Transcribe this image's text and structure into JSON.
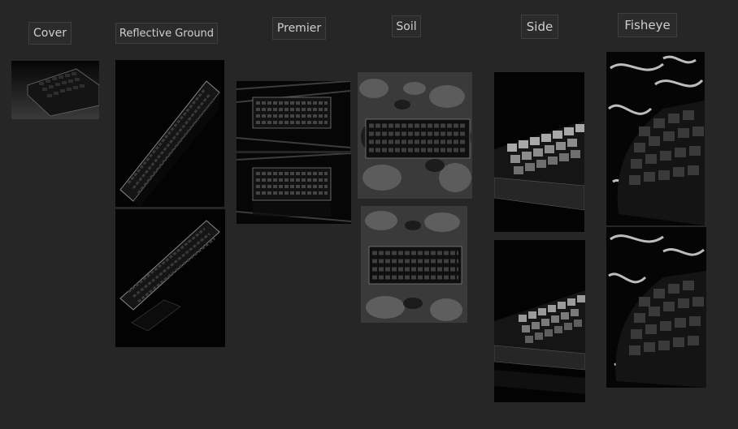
{
  "sections": [
    {
      "id": "cover",
      "title": "Cover"
    },
    {
      "id": "reflective",
      "title": "Reflective Ground"
    },
    {
      "id": "premier",
      "title": "Premier"
    },
    {
      "id": "soil",
      "title": "Soil"
    },
    {
      "id": "side",
      "title": "Side"
    },
    {
      "id": "fisheye",
      "title": "Fisheye"
    }
  ]
}
